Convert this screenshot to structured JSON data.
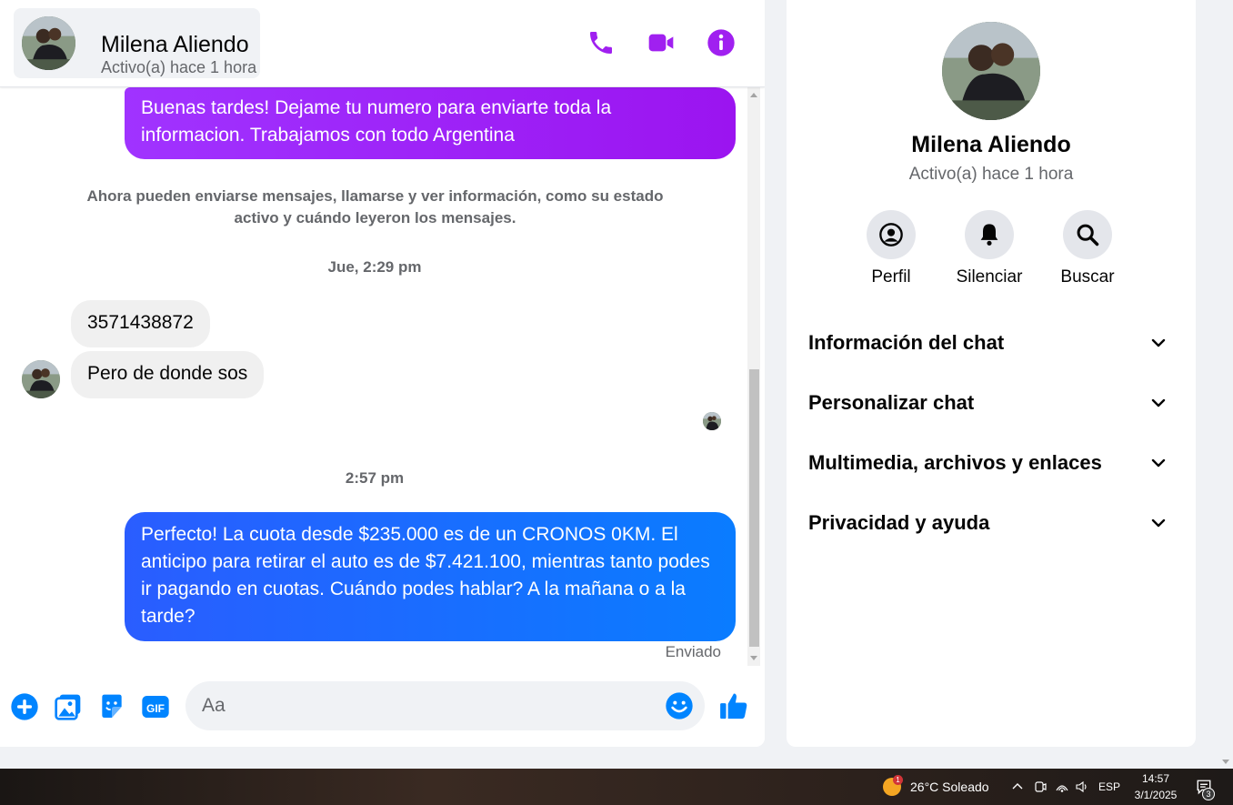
{
  "contact": {
    "name": "Milena Aliendo",
    "status": "Activo(a) hace 1 hora"
  },
  "messages": {
    "outgoing_1": "Buenas tardes! Dejame tu numero para enviarte toda la informacion. Trabajamos con todo Argentina",
    "system_note": "Ahora pueden enviarse mensajes, llamarse y ver información, como su estado activo y cuándo leyeron los mensajes.",
    "timestamp_1": "Jue, 2:29 pm",
    "incoming_1": "3571438872",
    "incoming_2": "Pero de donde sos",
    "timestamp_2": "2:57 pm",
    "outgoing_2": "Perfecto! La cuota desde $235.000 es de un CRONOS 0KM. El anticipo para retirar el auto es de $7.421.100, mientras tanto podes ir pagando en cuotas. Cuándo podes hablar? A la mañana o a la tarde?",
    "sent_label": "Enviado"
  },
  "composer": {
    "placeholder": "Aa"
  },
  "info_panel": {
    "actions": [
      {
        "label": "Perfil",
        "icon": "profile-icon"
      },
      {
        "label": "Silenciar",
        "icon": "bell-icon"
      },
      {
        "label": "Buscar",
        "icon": "search-icon"
      }
    ],
    "sections": [
      {
        "title": "Información del chat"
      },
      {
        "title": "Personalizar chat"
      },
      {
        "title": "Multimedia, archivos y enlaces"
      },
      {
        "title": "Privacidad y ayuda"
      }
    ]
  },
  "taskbar": {
    "weather_badge": "1",
    "weather": "26°C  Soleado",
    "language": "ESP",
    "time": "14:57",
    "date": "3/1/2025",
    "notification_count": "3"
  },
  "colors": {
    "accent_purple": "#9b14f0",
    "accent_blue": "#0a7cff",
    "messenger_blue": "#0084ff"
  }
}
